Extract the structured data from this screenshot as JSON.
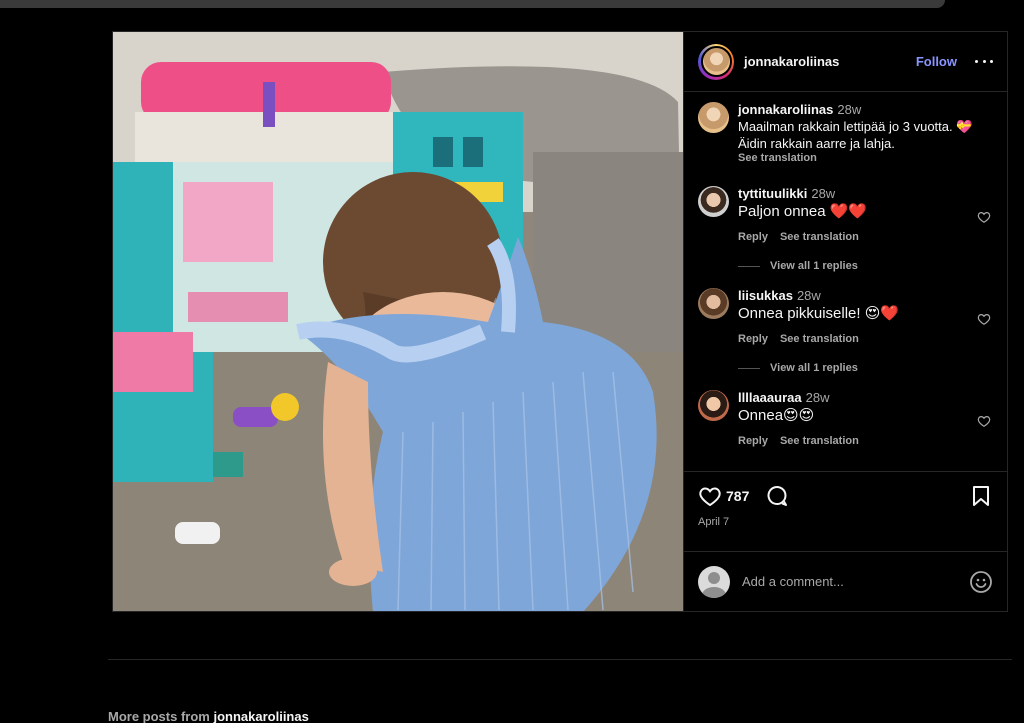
{
  "post": {
    "author": "jonnakaroliinas",
    "follow_label": "Follow",
    "caption": {
      "user": "jonnakaroliinas",
      "time": "28w",
      "line1": "Maailman rakkain lettipää jo 3 vuotta. 💝",
      "line2": "Äidin rakkain aarre ja lahja.",
      "see_translation": "See translation"
    },
    "comments": [
      {
        "user": "tyttituulikki",
        "time": "28w",
        "text": "Paljon onnea ❤️❤️",
        "reply": "Reply",
        "see_translation": "See translation",
        "view_replies": "View all 1 replies"
      },
      {
        "user": "liisukkas",
        "time": "28w",
        "text": "Onnea pikkuiselle! 😍❤️",
        "reply": "Reply",
        "see_translation": "See translation",
        "view_replies": "View all 1 replies"
      },
      {
        "user": "llllaaauraa",
        "time": "28w",
        "text": "Onnea😍😍",
        "reply": "Reply",
        "see_translation": "See translation"
      }
    ],
    "likes": "787",
    "date": "April 7",
    "add_comment_placeholder": "Add a comment..."
  },
  "footer": {
    "more_posts_prefix": "More posts from",
    "more_posts_user": "jonnakaroliinas"
  },
  "colors": {
    "background": "#000000",
    "border": "#262626",
    "follow": "#8a95ff",
    "muted": "#a8a8a8"
  },
  "icons": [
    "heart-icon",
    "comment-icon",
    "bookmark-icon",
    "emoji-icon",
    "more-icon"
  ]
}
